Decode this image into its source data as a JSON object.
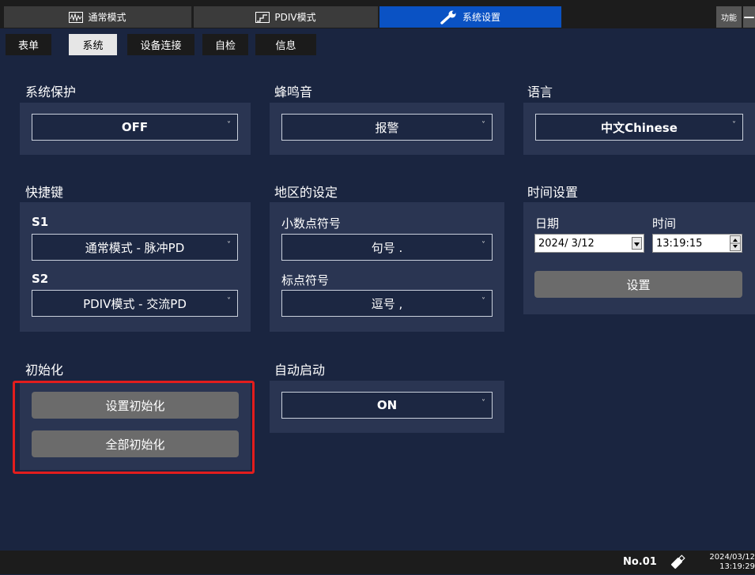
{
  "top_tabs": [
    {
      "label": "通常模式",
      "icon": "waveform-icon"
    },
    {
      "label": "PDIV模式",
      "icon": "step-chart-icon"
    },
    {
      "label": "系统设置",
      "icon": "wrench-icon"
    }
  ],
  "function_label": "功能",
  "minimize_label": "—",
  "sub_tabs": [
    "表单",
    "系统",
    "设备连接",
    "自检",
    "信息"
  ],
  "system_protection": {
    "heading": "系统保护",
    "value": "OFF"
  },
  "buzzer": {
    "heading": "蜂鸣音",
    "value": "报警"
  },
  "language": {
    "heading": "语言",
    "value": "中文Chinese"
  },
  "shortcut": {
    "heading": "快捷键",
    "s1_label": "S1",
    "s1_value": "通常模式 - 脉冲PD",
    "s2_label": "S2",
    "s2_value": "PDIV模式 - 交流PD"
  },
  "region": {
    "heading": "地区的设定",
    "decimal_label": "小数点符号",
    "decimal_value": "句号 .",
    "punct_label": "标点符号",
    "punct_value": "逗号 ,"
  },
  "time_setting": {
    "heading": "时间设置",
    "date_label": "日期",
    "date_value": "2024/ 3/12",
    "time_label": "时间",
    "time_value": "13:19:15",
    "set_button": "设置"
  },
  "init": {
    "heading": "初始化",
    "reset_settings": "设置初始化",
    "reset_all": "全部初始化"
  },
  "auto_start": {
    "heading": "自动启动",
    "value": "ON"
  },
  "status": {
    "number": "No.01",
    "date": "2024/03/12",
    "time": "13:19:29"
  },
  "colors": {
    "active_tab": "#0a52c4",
    "background": "#1a2540",
    "panel": "#2a3552",
    "highlight": "#e31d1d"
  }
}
